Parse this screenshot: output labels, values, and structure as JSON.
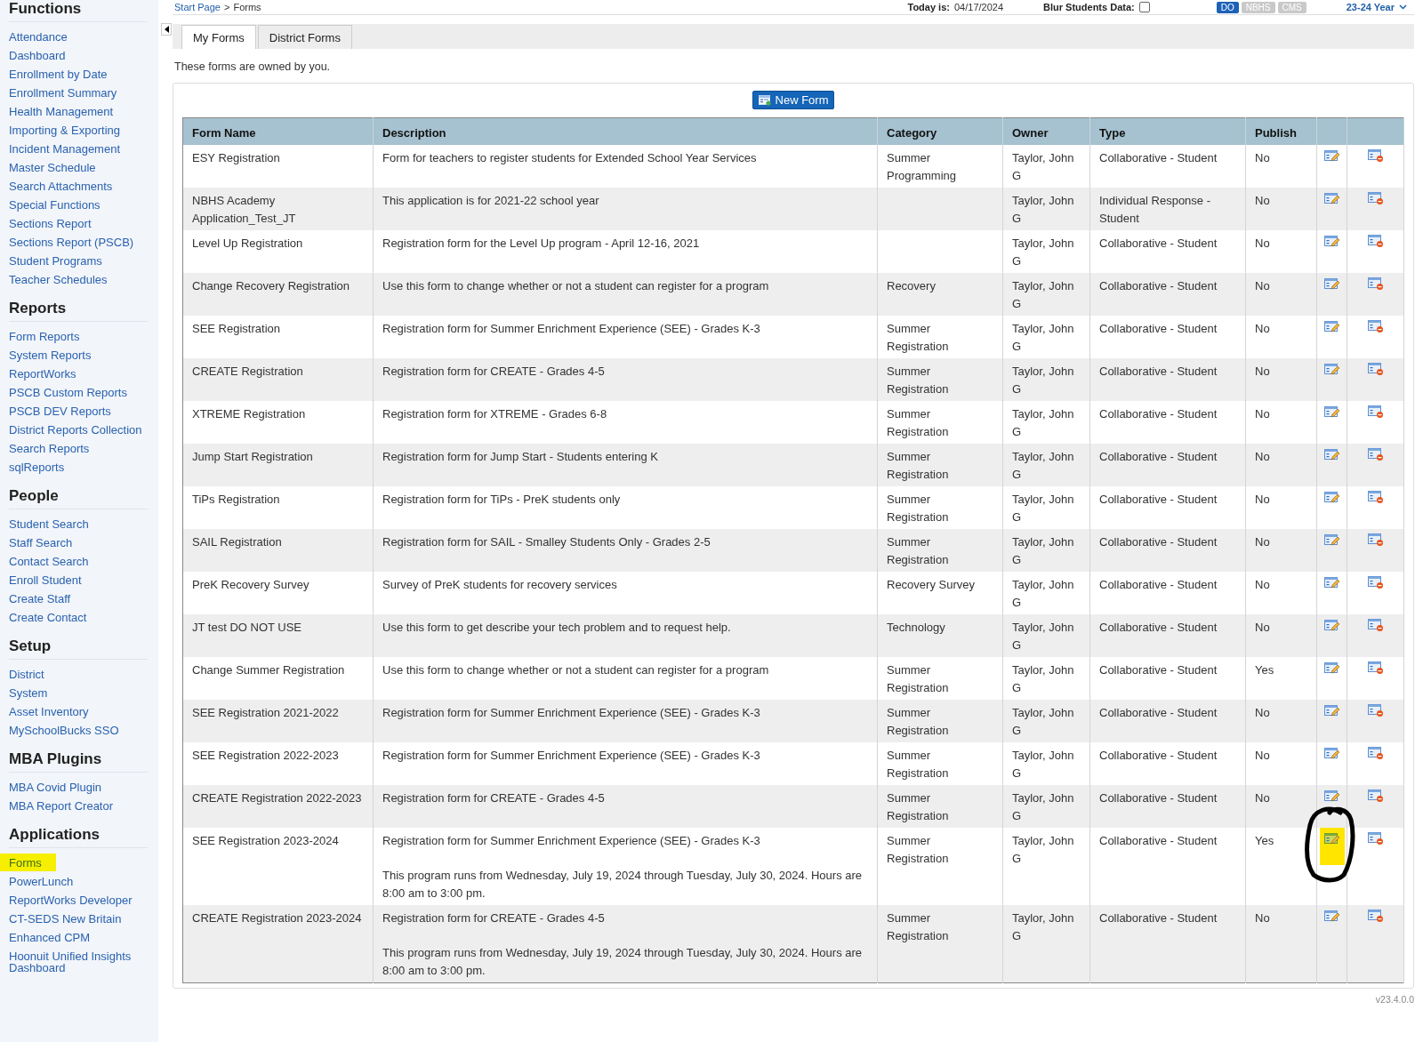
{
  "top_bar": {
    "breadcrumb": {
      "link": "Start Page",
      "separator": ">",
      "current": "Forms"
    },
    "today_label": "Today is:",
    "today_value": "04/17/2024",
    "blur_label": "Blur Students Data:",
    "blur_checked": false,
    "schools": [
      {
        "label": "DO",
        "selected": true
      },
      {
        "label": "NBHS",
        "selected": false
      },
      {
        "label": "CMS",
        "selected": false
      }
    ],
    "year": "23-24 Year"
  },
  "sidebar": {
    "sections": [
      {
        "title": "Functions",
        "items": [
          {
            "label": "Attendance",
            "highlighted": false
          },
          {
            "label": "Dashboard",
            "highlighted": false
          },
          {
            "label": "Enrollment by Date",
            "highlighted": false
          },
          {
            "label": "Enrollment Summary",
            "highlighted": false
          },
          {
            "label": "Health Management",
            "highlighted": false
          },
          {
            "label": "Importing & Exporting",
            "highlighted": false
          },
          {
            "label": "Incident Management",
            "highlighted": false
          },
          {
            "label": "Master Schedule",
            "highlighted": false
          },
          {
            "label": "Search Attachments",
            "highlighted": false
          },
          {
            "label": "Special Functions",
            "highlighted": false
          },
          {
            "label": "Sections Report",
            "highlighted": false
          },
          {
            "label": "Sections Report (PSCB)",
            "highlighted": false
          },
          {
            "label": "Student Programs",
            "highlighted": false
          },
          {
            "label": "Teacher Schedules",
            "highlighted": false
          }
        ]
      },
      {
        "title": "Reports",
        "items": [
          {
            "label": "Form Reports",
            "highlighted": false
          },
          {
            "label": "System Reports",
            "highlighted": false
          },
          {
            "label": "ReportWorks",
            "highlighted": false
          },
          {
            "label": "PSCB Custom Reports",
            "highlighted": false
          },
          {
            "label": "PSCB DEV Reports",
            "highlighted": false
          },
          {
            "label": "District Reports Collection",
            "highlighted": false
          },
          {
            "label": "Search Reports",
            "highlighted": false
          },
          {
            "label": "sqlReports",
            "highlighted": false
          }
        ]
      },
      {
        "title": "People",
        "items": [
          {
            "label": "Student Search",
            "highlighted": false
          },
          {
            "label": "Staff Search",
            "highlighted": false
          },
          {
            "label": "Contact Search",
            "highlighted": false
          },
          {
            "label": "Enroll Student",
            "highlighted": false
          },
          {
            "label": "Create Staff",
            "highlighted": false
          },
          {
            "label": "Create Contact",
            "highlighted": false
          }
        ]
      },
      {
        "title": "Setup",
        "items": [
          {
            "label": "District",
            "highlighted": false
          },
          {
            "label": "System",
            "highlighted": false
          },
          {
            "label": "Asset Inventory",
            "highlighted": false
          },
          {
            "label": "MySchoolBucks SSO",
            "highlighted": false
          }
        ]
      },
      {
        "title": "MBA Plugins",
        "items": [
          {
            "label": "MBA Covid Plugin",
            "highlighted": false
          },
          {
            "label": "MBA Report Creator",
            "highlighted": false
          }
        ]
      },
      {
        "title": "Applications",
        "items": [
          {
            "label": "Forms",
            "highlighted": true
          },
          {
            "label": "PowerLunch",
            "highlighted": false
          },
          {
            "label": "ReportWorks Developer",
            "highlighted": false
          },
          {
            "label": "CT-SEDS New Britain",
            "highlighted": false
          },
          {
            "label": "Enhanced CPM",
            "highlighted": false
          },
          {
            "label": "Hoonuit Unified Insights Dashboard",
            "highlighted": false
          }
        ]
      }
    ]
  },
  "tabs": [
    {
      "label": "My Forms",
      "selected": true
    },
    {
      "label": "District Forms",
      "selected": false
    }
  ],
  "intro": "These forms are owned by you.",
  "new_form_button": "New Form",
  "table": {
    "columns": [
      "Form Name",
      "Description",
      "Category",
      "Owner",
      "Type",
      "Publish"
    ],
    "rows": [
      {
        "name": "ESY Registration",
        "description": [
          "Form for teachers to register students for Extended School Year Services"
        ],
        "category": "Summer Programming",
        "owner": "Taylor, John G",
        "type": "Collaborative - Student",
        "publish": "No",
        "highlighted": false
      },
      {
        "name": "NBHS Academy Application_Test_JT",
        "description": [
          "This application is for 2021-22 school year"
        ],
        "category": "",
        "owner": "Taylor, John G",
        "type": "Individual Response - Student",
        "publish": "No",
        "highlighted": false
      },
      {
        "name": "Level Up Registration",
        "description": [
          "Registration form for the Level Up program - April 12-16, 2021"
        ],
        "category": "",
        "owner": "Taylor, John G",
        "type": "Collaborative - Student",
        "publish": "No",
        "highlighted": false
      },
      {
        "name": "Change Recovery Registration",
        "description": [
          "Use this form to change whether or not a student can register for a program"
        ],
        "category": "Recovery",
        "owner": "Taylor, John G",
        "type": "Collaborative - Student",
        "publish": "No",
        "highlighted": false
      },
      {
        "name": "SEE Registration",
        "description": [
          "Registration form for Summer Enrichment Experience (SEE) - Grades K-3"
        ],
        "category": "Summer Registration",
        "owner": "Taylor, John G",
        "type": "Collaborative - Student",
        "publish": "No",
        "highlighted": false
      },
      {
        "name": "CREATE Registration",
        "description": [
          "Registration form for CREATE - Grades 4-5"
        ],
        "category": "Summer Registration",
        "owner": "Taylor, John G",
        "type": "Collaborative - Student",
        "publish": "No",
        "highlighted": false
      },
      {
        "name": "XTREME Registration",
        "description": [
          "Registration form for XTREME - Grades 6-8"
        ],
        "category": "Summer Registration",
        "owner": "Taylor, John G",
        "type": "Collaborative - Student",
        "publish": "No",
        "highlighted": false
      },
      {
        "name": "Jump Start Registration",
        "description": [
          "Registration form for Jump Start - Students entering K"
        ],
        "category": "Summer Registration",
        "owner": "Taylor, John G",
        "type": "Collaborative - Student",
        "publish": "No",
        "highlighted": false
      },
      {
        "name": "TiPs Registration",
        "description": [
          "Registration form for TiPs - PreK students only"
        ],
        "category": "Summer Registration",
        "owner": "Taylor, John G",
        "type": "Collaborative - Student",
        "publish": "No",
        "highlighted": false
      },
      {
        "name": "SAIL Registration",
        "description": [
          "Registration form for SAIL - Smalley Students Only - Grades 2-5"
        ],
        "category": "Summer Registration",
        "owner": "Taylor, John G",
        "type": "Collaborative - Student",
        "publish": "No",
        "highlighted": false
      },
      {
        "name": "PreK Recovery Survey",
        "description": [
          "Survey of PreK students for recovery services"
        ],
        "category": "Recovery Survey",
        "owner": "Taylor, John G",
        "type": "Collaborative - Student",
        "publish": "No",
        "highlighted": false
      },
      {
        "name": "JT test DO NOT USE",
        "description": [
          "Use this form to get describe your tech problem and to request help."
        ],
        "category": "Technology",
        "owner": "Taylor, John G",
        "type": "Collaborative - Student",
        "publish": "No",
        "highlighted": false
      },
      {
        "name": "Change Summer Registration",
        "description": [
          "Use this form to change whether or not a student can register for a program"
        ],
        "category": "Summer Registration",
        "owner": "Taylor, John G",
        "type": "Collaborative - Student",
        "publish": "Yes",
        "highlighted": false
      },
      {
        "name": "SEE Registration 2021-2022",
        "description": [
          "Registration form for Summer Enrichment Experience (SEE) - Grades K-3"
        ],
        "category": "Summer Registration",
        "owner": "Taylor, John G",
        "type": "Collaborative - Student",
        "publish": "No",
        "highlighted": false
      },
      {
        "name": "SEE Registration 2022-2023",
        "description": [
          "Registration form for Summer Enrichment Experience (SEE) - Grades K-3"
        ],
        "category": "Summer Registration",
        "owner": "Taylor, John G",
        "type": "Collaborative - Student",
        "publish": "No",
        "highlighted": false
      },
      {
        "name": "CREATE Registration 2022-2023",
        "description": [
          "Registration form for CREATE - Grades 4-5"
        ],
        "category": "Summer Registration",
        "owner": "Taylor, John G",
        "type": "Collaborative - Student",
        "publish": "No",
        "highlighted": false
      },
      {
        "name": "SEE Registration 2023-2024",
        "description": [
          "Registration form for Summer Enrichment Experience (SEE) - Grades K-3",
          "This program runs from Wednesday, July 19, 2024 through Tuesday, July 30, 2024. Hours are 8:00 am to 3:00 pm."
        ],
        "category": "Summer Registration",
        "owner": "Taylor, John G",
        "type": "Collaborative - Student",
        "publish": "Yes",
        "highlighted": true
      },
      {
        "name": "CREATE Registration 2023-2024",
        "description": [
          "Registration form for CREATE - Grades 4-5",
          "This program runs from Wednesday, July 19, 2024 through Tuesday, July 30, 2024. Hours are 8:00 am to 3:00 pm."
        ],
        "category": "Summer Registration",
        "owner": "Taylor, John G",
        "type": "Collaborative - Student",
        "publish": "No",
        "highlighted": false
      }
    ]
  },
  "version": "v23.4.0.0"
}
